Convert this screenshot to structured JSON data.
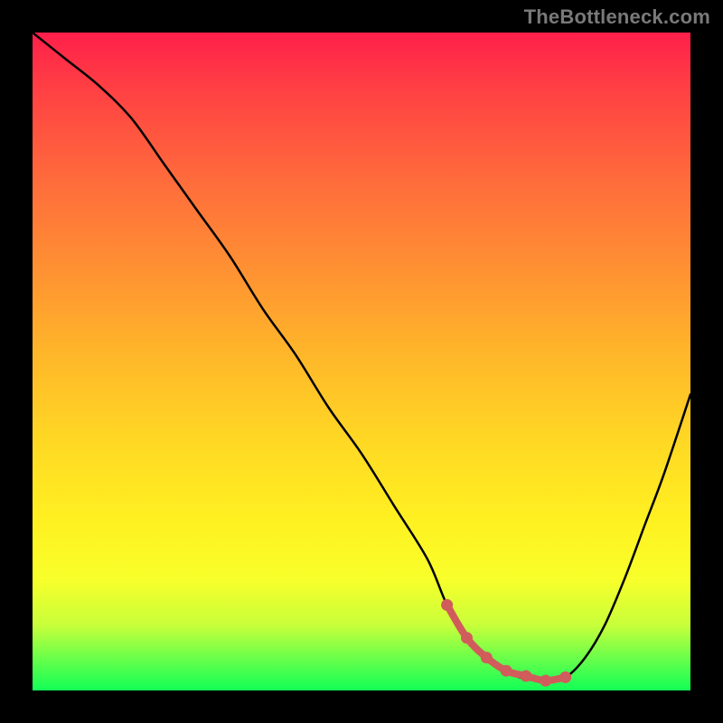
{
  "watermark": "TheBottleneck.com",
  "chart_data": {
    "type": "line",
    "title": "",
    "xlabel": "",
    "ylabel": "",
    "xlim": [
      0,
      100
    ],
    "ylim": [
      0,
      100
    ],
    "series": [
      {
        "name": "bottleneck-curve",
        "color": "#000000",
        "x": [
          0,
          5,
          10,
          15,
          20,
          25,
          30,
          35,
          40,
          45,
          50,
          55,
          60,
          63,
          66,
          70,
          74,
          78,
          81,
          84,
          87,
          90,
          93,
          96,
          100
        ],
        "values": [
          100,
          96,
          92,
          87,
          80,
          73,
          66,
          58,
          51,
          43,
          36,
          28,
          20,
          13,
          8,
          4,
          2,
          1.5,
          2,
          5,
          10,
          17,
          25,
          33,
          45
        ]
      }
    ],
    "annotations": [
      {
        "name": "optimal-band",
        "type": "markers",
        "color": "#d15c5c",
        "x": [
          63,
          66,
          69,
          72,
          75,
          78,
          81
        ],
        "values": [
          13,
          8,
          5,
          3,
          2.2,
          1.5,
          2
        ]
      }
    ],
    "background_gradient_meaning": "top = high bottleneck (red), bottom = no bottleneck (green)"
  }
}
